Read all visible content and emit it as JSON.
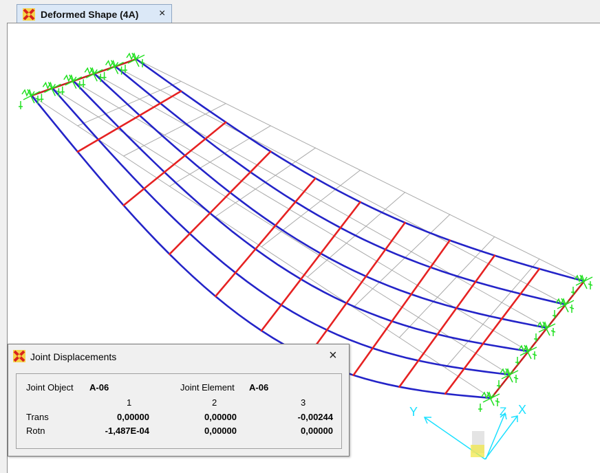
{
  "tab": {
    "title": "Deformed Shape (4A)",
    "close": "×",
    "icon": "sap-logo-icon"
  },
  "dialog": {
    "title": "Joint Displacements",
    "close": "×",
    "icon": "sap-logo-icon",
    "joint_object_label": "Joint Object",
    "joint_object_value": "A-06",
    "joint_element_label": "Joint Element",
    "joint_element_value": "A-06",
    "columns": [
      "1",
      "2",
      "3"
    ],
    "rows": [
      {
        "label": "Trans",
        "values": [
          "0,00000",
          "0,00000",
          "-0,00244"
        ]
      },
      {
        "label": "Rotn",
        "values": [
          "-1,487E-04",
          "0,00000",
          "0,00000"
        ]
      }
    ]
  },
  "axes": {
    "x": "X",
    "y": "Y",
    "z": "Z"
  },
  "colors": {
    "grid": "#a9a9a9",
    "girder": "#2424c8",
    "crossbeam": "#e62222",
    "support": "#22e022",
    "axes": "#1ce0ff",
    "tab_bg": "#dbe8f7"
  }
}
